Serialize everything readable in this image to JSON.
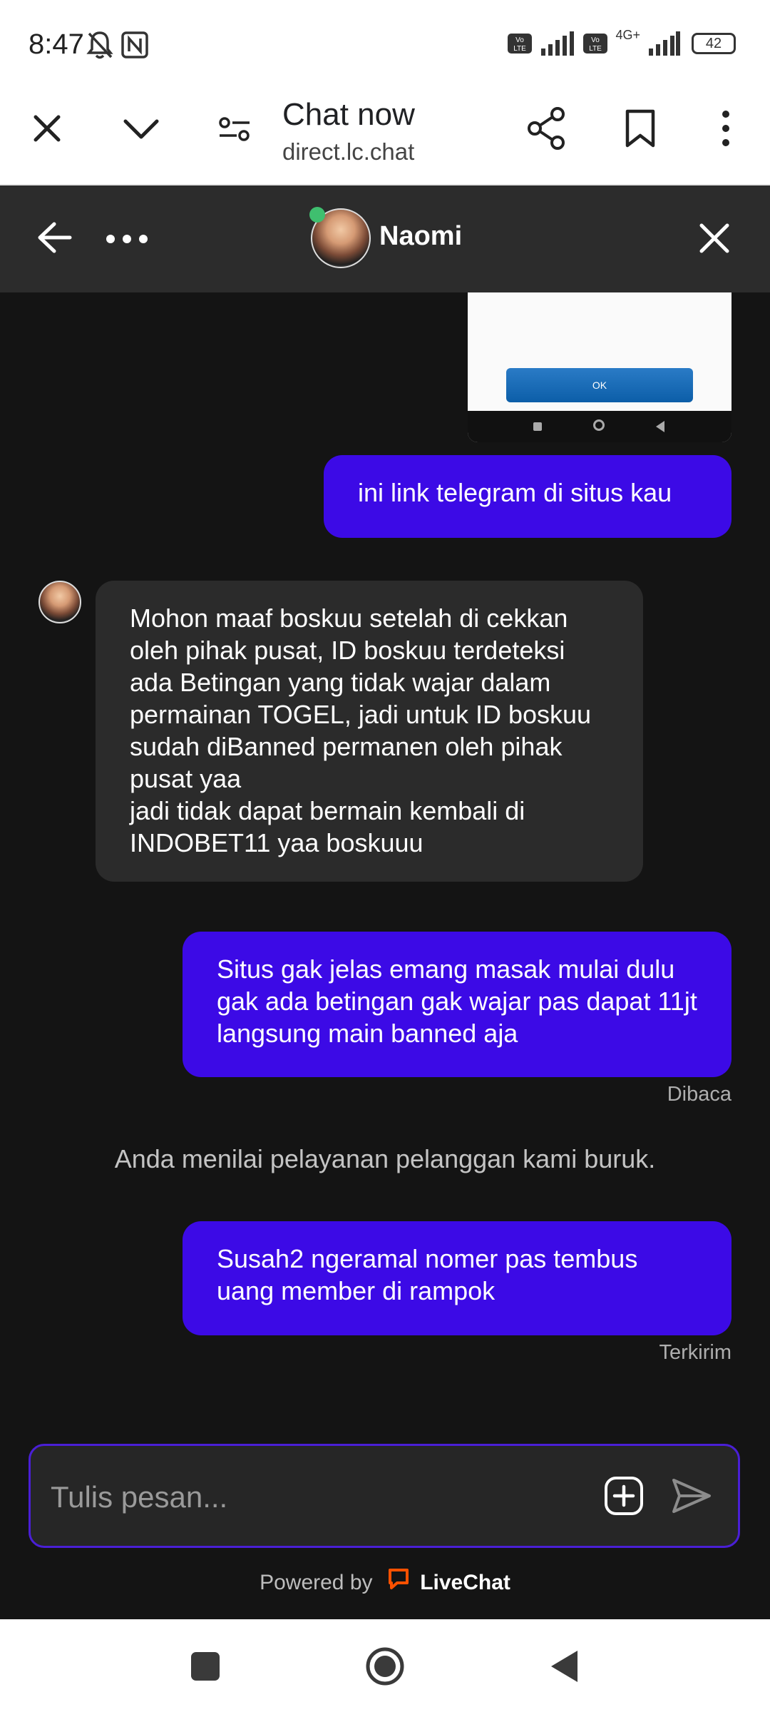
{
  "status_bar": {
    "time": "8:47",
    "battery": "42",
    "network_label": "4G+"
  },
  "browser": {
    "title": "Chat now",
    "url": "direct.lc.chat"
  },
  "chat_header": {
    "agent_name": "Naomi"
  },
  "screenshot_preview": {
    "button_label": "OK"
  },
  "messages": [
    {
      "direction": "out",
      "text": "ini link telegram di situs kau"
    },
    {
      "direction": "in",
      "text": "Mohon maaf boskuu setelah di cekkan oleh pihak pusat, ID boskuu terdeteksi ada Betingan yang tidak wajar dalam permainan TOGEL, jadi untuk ID boskuu sudah diBanned permanen oleh pihak pusat yaa\njadi tidak dapat bermain kembali di INDOBET11 yaa boskuuu"
    },
    {
      "direction": "out",
      "text": "Situs gak jelas emang masak mulai dulu gak ada betingan gak wajar pas dapat 11jt langsung main banned aja",
      "status": "Dibaca"
    },
    {
      "direction": "out",
      "text": "Susah2 ngeramal nomer pas tembus uang member di rampok",
      "status": "Terkirim"
    }
  ],
  "system_message": "Anda menilai pelayanan pelanggan kami buruk.",
  "composer": {
    "placeholder": "Tulis pesan..."
  },
  "footer": {
    "powered_by": "Powered by",
    "brand": "LiveChat"
  },
  "colors": {
    "outgoing_bubble": "#3c0ae6",
    "incoming_bubble": "#2b2b2b",
    "chat_bg": "#141414",
    "header_bg": "#2c2c2c",
    "livechat_brand": "#ff5100",
    "online_dot": "#3fbf6f"
  }
}
